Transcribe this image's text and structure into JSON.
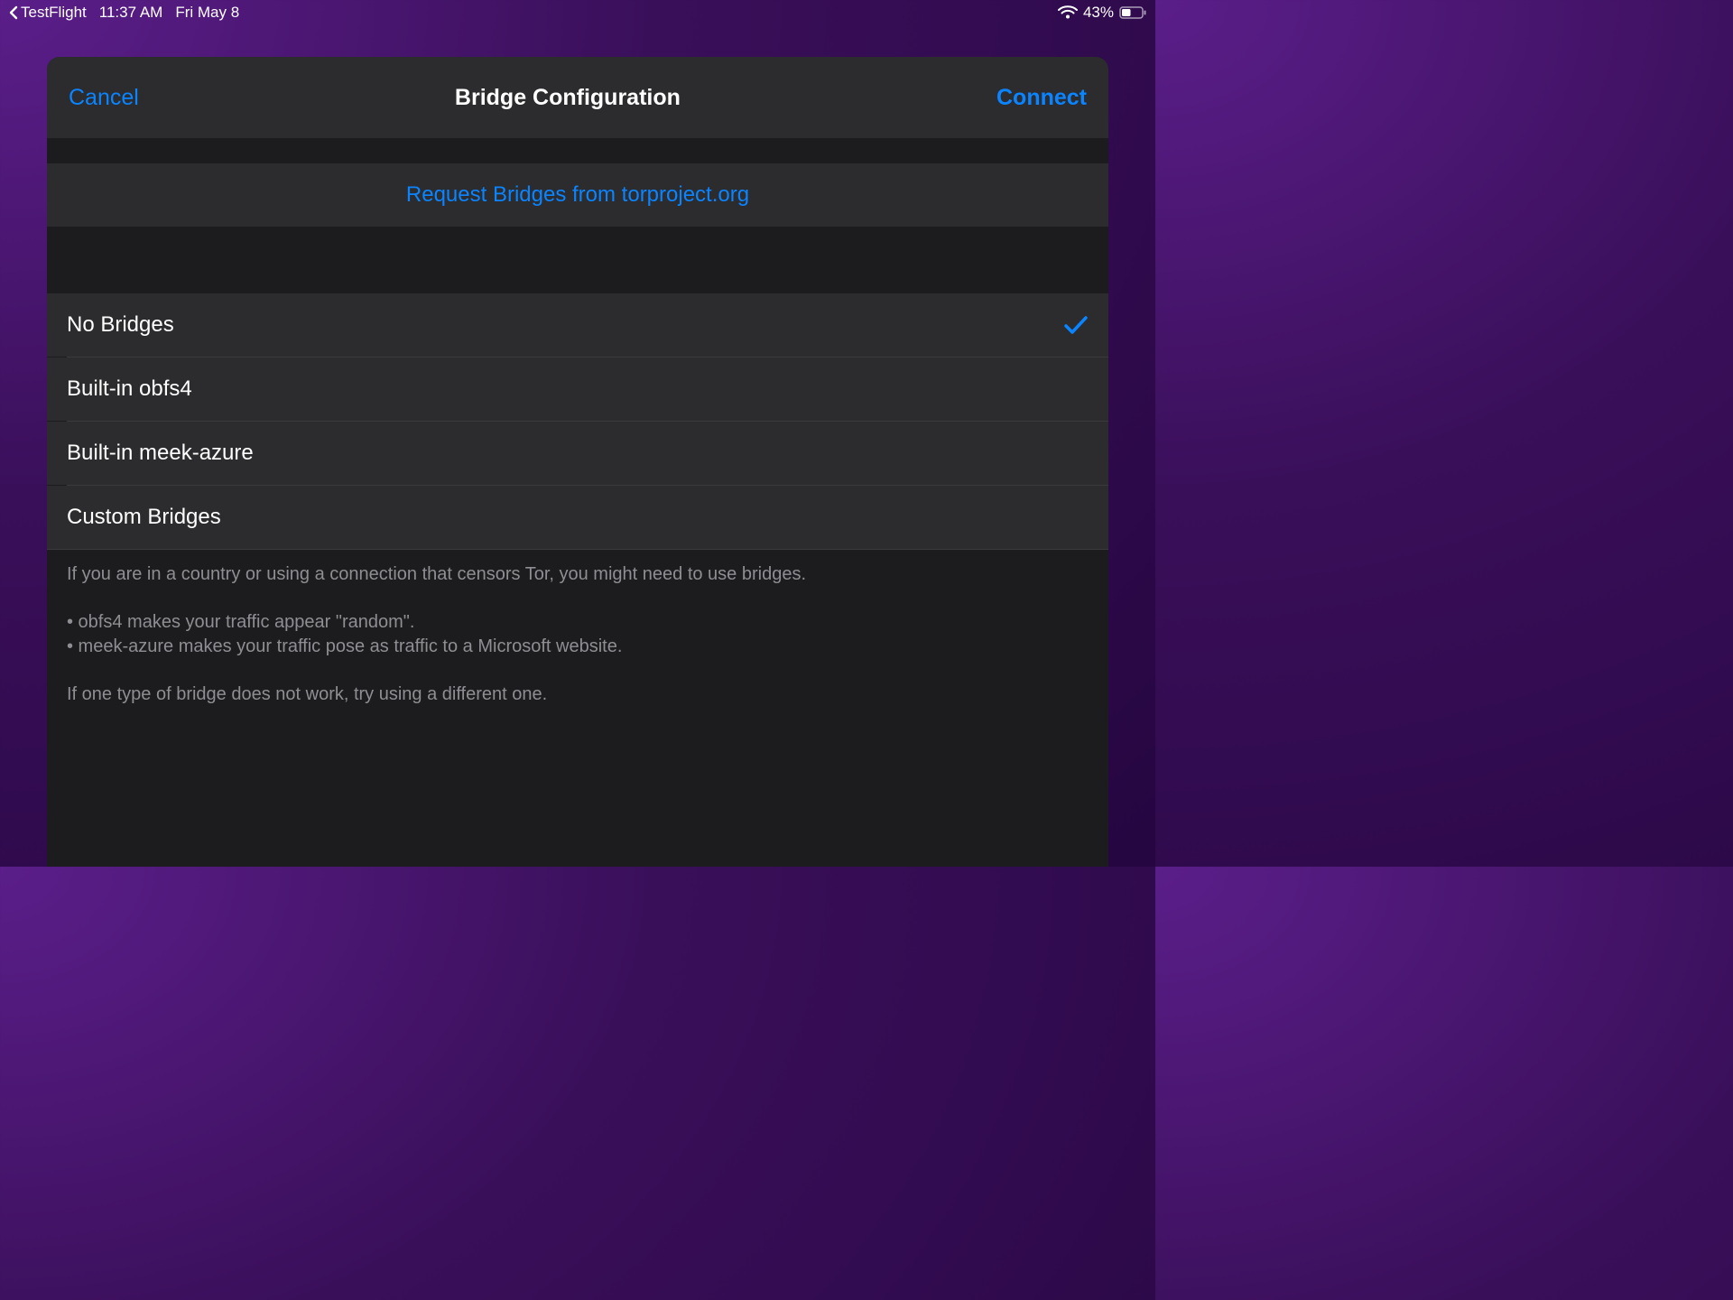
{
  "status_bar": {
    "back_app": "TestFlight",
    "time": "11:37 AM",
    "date": "Fri May 8",
    "battery_percent": "43%"
  },
  "nav": {
    "cancel": "Cancel",
    "title": "Bridge Configuration",
    "connect": "Connect"
  },
  "request_link": "Request Bridges from torproject.org",
  "options": {
    "0": {
      "label": "No Bridges",
      "selected": true
    },
    "1": {
      "label": "Built-in obfs4",
      "selected": false
    },
    "2": {
      "label": "Built-in meek-azure",
      "selected": false
    },
    "3": {
      "label": "Custom Bridges",
      "selected": false
    }
  },
  "footer": {
    "p1": "If you are in a country or using a connection that censors Tor, you might need to use bridges.",
    "b1": "• obfs4 makes your traffic appear \"random\".",
    "b2": "• meek-azure makes your traffic pose as traffic to a Microsoft website.",
    "p2": "If one type of bridge does not work, try using a different one."
  },
  "colors": {
    "accent": "#0a84ff"
  }
}
